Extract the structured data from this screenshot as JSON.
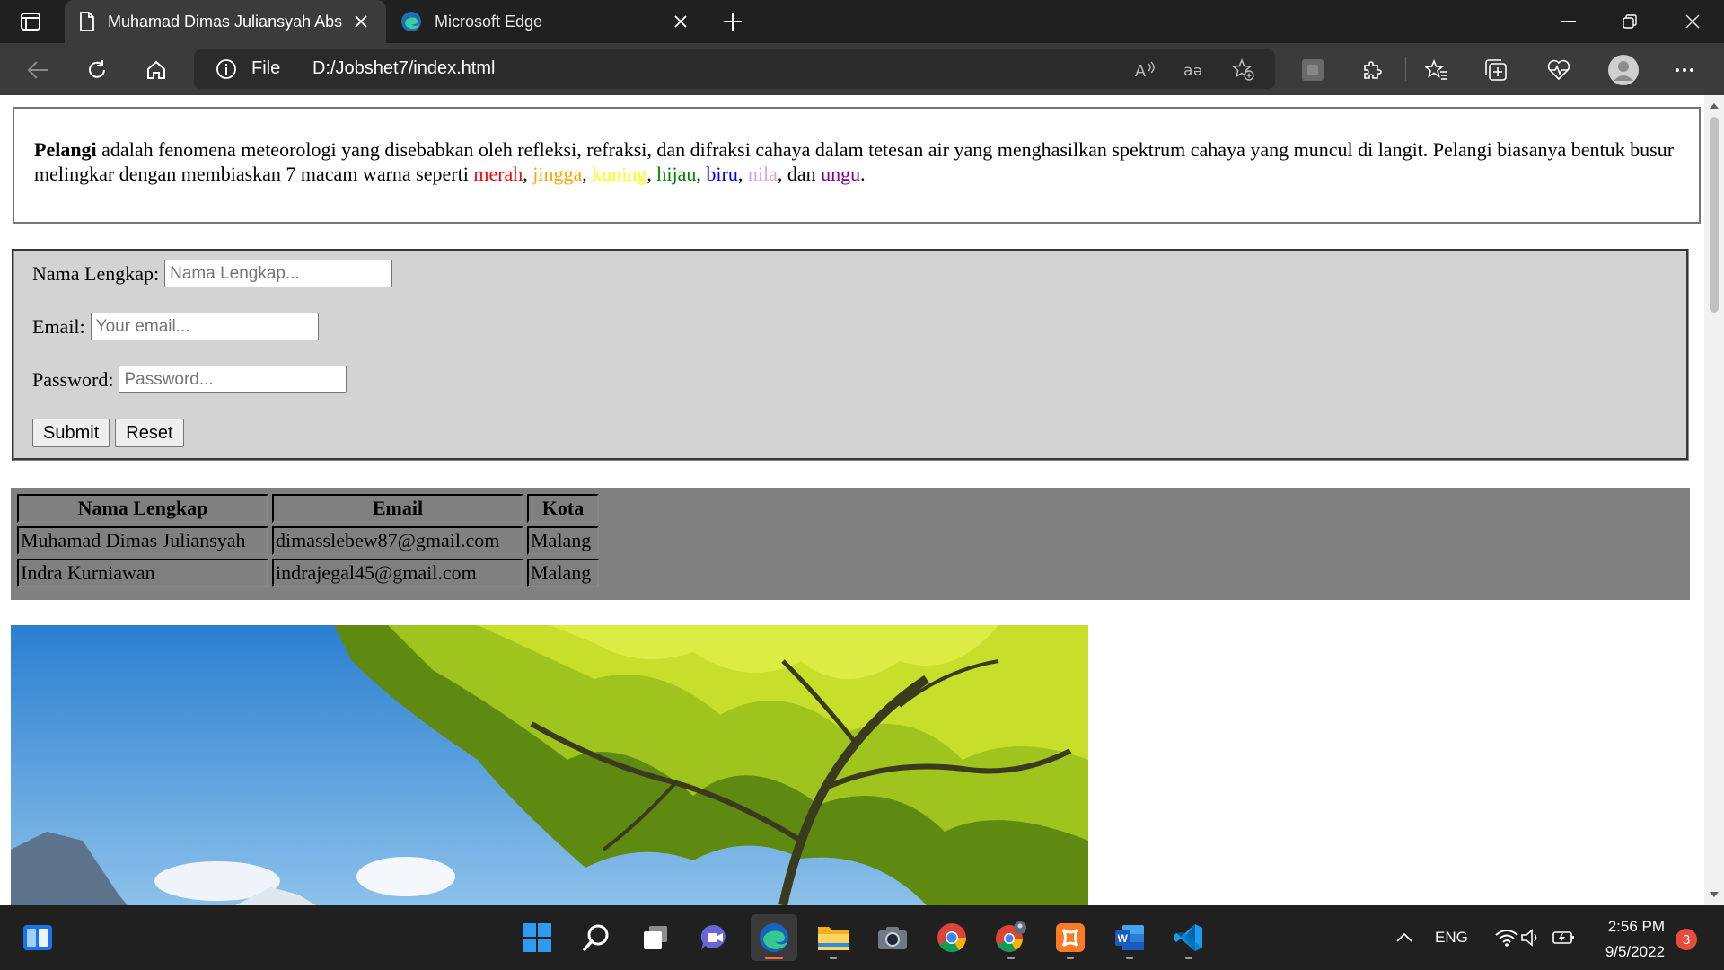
{
  "browser": {
    "tabs": [
      {
        "title": "Muhamad Dimas Juliansyah Abs",
        "active": true
      },
      {
        "title": "Microsoft Edge",
        "active": false
      }
    ],
    "address": {
      "scheme": "File",
      "url": "D:/Jobshet7/index.html"
    }
  },
  "page": {
    "paragraph": {
      "bold_term": "Pelangi",
      "text_main": " adalah fenomena meteorologi yang disebabkan oleh refleksi, refraksi, dan difraksi cahaya dalam tetesan air yang menghasilkan spektrum cahaya yang muncul di langit. Pelangi biasanya bentuk busur melingkar dengan membiaskan 7 macam warna seperti ",
      "colors": [
        {
          "word": "merah",
          "color": "#ff0000"
        },
        {
          "word": "jingga",
          "color": "#ffa500"
        },
        {
          "word": "kuning",
          "color": "#ffff00"
        },
        {
          "word": "hijau",
          "color": "#008000"
        },
        {
          "word": "biru",
          "color": "#0000ff"
        },
        {
          "word": "nila",
          "color": "#dda0dd"
        },
        {
          "word": "ungu",
          "color": "#800080"
        }
      ],
      "sep_comma": ", ",
      "sep_dan": ", dan ",
      "end": "."
    },
    "form": {
      "name_label": "Nama Lengkap:",
      "name_placeholder": "Nama Lengkap...",
      "email_label": "Email:",
      "email_placeholder": "Your email...",
      "password_label": "Password:",
      "password_placeholder": "Password...",
      "submit_label": "Submit",
      "reset_label": "Reset"
    },
    "table": {
      "headers": [
        "Nama Lengkap",
        "Email",
        "Kota"
      ],
      "rows": [
        [
          "Muhamad Dimas Juliansyah",
          "dimasslebew87@gmail.com",
          "Malang"
        ],
        [
          "Indra Kurniawan",
          "indrajegal45@gmail.com",
          "Malang"
        ]
      ]
    }
  },
  "taskbar": {
    "language": "ENG",
    "time": "2:56 PM",
    "date": "9/5/2022",
    "notifications": "3"
  }
}
